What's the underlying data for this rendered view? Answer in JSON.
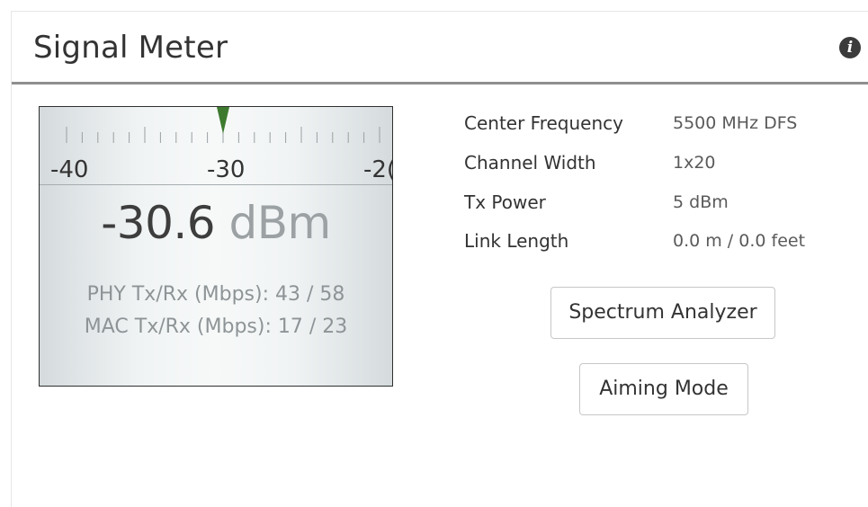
{
  "panel": {
    "title": "Signal Meter",
    "info_icon": "info-icon"
  },
  "meter": {
    "scale": {
      "labels": [
        "-40",
        "-30",
        "-2("
      ],
      "pointer_value": -30
    },
    "reading_value": "-30.6",
    "reading_unit": "dBm",
    "phy": "PHY Tx/Rx (Mbps): 43 / 58",
    "mac": "MAC Tx/Rx (Mbps): 17 / 23",
    "pointer_color": "#3d7a2f"
  },
  "info": {
    "rows": [
      {
        "label": "Center Frequency",
        "value": "5500 MHz DFS"
      },
      {
        "label": "Channel Width",
        "value": "1x20"
      },
      {
        "label": "Tx Power",
        "value": "5 dBm"
      },
      {
        "label": "Link Length",
        "value": "0.0 m / 0.0 feet"
      }
    ]
  },
  "buttons": {
    "spectrum_analyzer": "Spectrum Analyzer",
    "aiming_mode": "Aiming Mode"
  }
}
